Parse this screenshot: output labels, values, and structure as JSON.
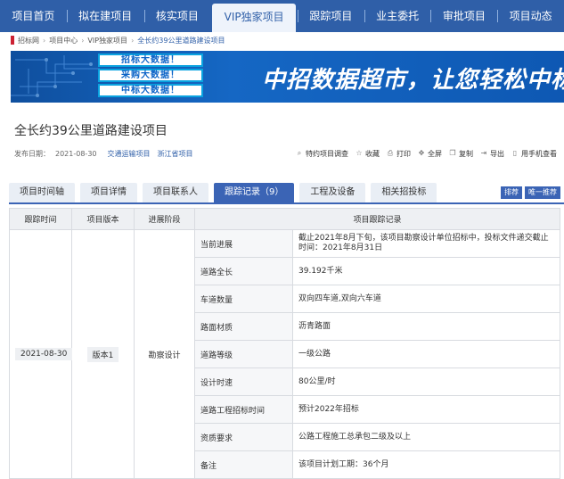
{
  "nav": {
    "items": [
      "项目首页",
      "拟在建项目",
      "核实项目",
      "VIP独家项目",
      "跟踪项目",
      "业主委托",
      "审批项目",
      "项目动态"
    ],
    "active_index": 3
  },
  "breadcrumb": {
    "items": [
      "招标网",
      "项目中心",
      "VIP独家项目",
      "全长约39公里道路建设项目"
    ]
  },
  "banner": {
    "tags": [
      "招标大数据！",
      "采购大数据！",
      "中标大数据！"
    ],
    "slogan": "中招数据超市，让您轻松中标"
  },
  "project": {
    "title": "全长约39公里道路建设项目",
    "publish_label": "发布日期：",
    "publish_date": "2021-08-30",
    "category_links": [
      "交通运输项目",
      "浙江省项目"
    ]
  },
  "tools": [
    {
      "icon": "magnifier-icon",
      "label": "特约项目调查"
    },
    {
      "icon": "star-icon",
      "label": "收藏"
    },
    {
      "icon": "printer-icon",
      "label": "打印"
    },
    {
      "icon": "fullscreen-icon",
      "label": "全屏"
    },
    {
      "icon": "copy-icon",
      "label": "复制"
    },
    {
      "icon": "export-icon",
      "label": "导出"
    },
    {
      "icon": "mobile-icon",
      "label": "用手机查看"
    }
  ],
  "tabs": {
    "items": [
      "项目时间轴",
      "项目详情",
      "项目联系人",
      "跟踪记录（9）",
      "工程及设备",
      "相关招投标"
    ],
    "active_index": 3,
    "buttons": [
      "排荐",
      "唯一推荐"
    ]
  },
  "table": {
    "headers": [
      "跟踪时间",
      "项目版本",
      "进展阶段",
      "项目跟踪记录"
    ],
    "row_date": "2021-08-30",
    "row_version": "版本1",
    "row_stage": "勘察设计",
    "records": [
      {
        "label": "当前进展",
        "value": "截止2021年8月下旬，该项目勘察设计单位招标中，投标文件递交截止时间：2021年8月31日"
      },
      {
        "label": "道路全长",
        "value": "39.192千米"
      },
      {
        "label": "车道数量",
        "value": "双向四车道,双向六车道"
      },
      {
        "label": "路面材质",
        "value": "沥青路面"
      },
      {
        "label": "道路等级",
        "value": "一级公路"
      },
      {
        "label": "设计时速",
        "value": "80公里/时"
      },
      {
        "label": "道路工程招标时间",
        "value": "预计2022年招标"
      },
      {
        "label": "资质要求",
        "value": "公路工程施工总承包二级及以上"
      },
      {
        "label": "备注",
        "value": "该项目计划工期：36个月"
      }
    ]
  },
  "colors": {
    "nav_bg": "#2f5fa8",
    "tab_active": "#3b64b5",
    "link": "#2f5fa8"
  }
}
